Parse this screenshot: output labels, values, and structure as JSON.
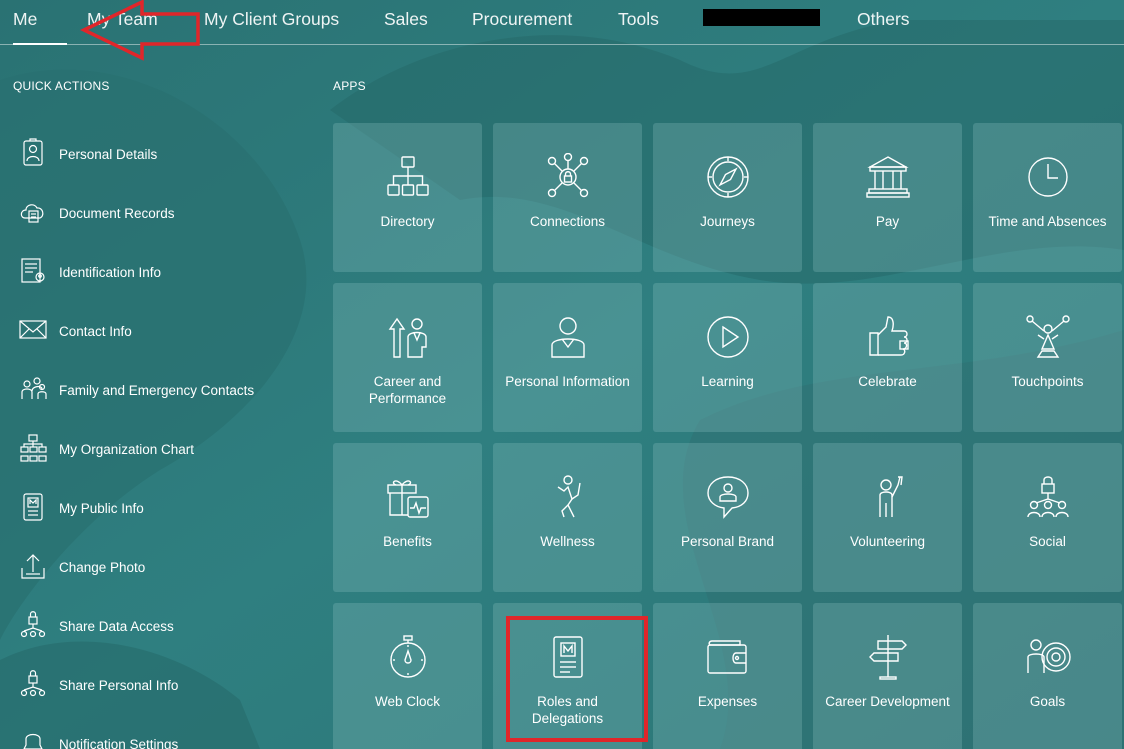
{
  "nav": {
    "tabs": [
      "Me",
      "My Team",
      "My Client Groups",
      "Sales",
      "Procurement",
      "Tools",
      "Others"
    ],
    "active_tab": "Me"
  },
  "quick_actions": {
    "heading": "QUICK ACTIONS",
    "items": [
      {
        "label": "Personal Details",
        "icon": "person-card-icon"
      },
      {
        "label": "Document Records",
        "icon": "cloud-document-icon"
      },
      {
        "label": "Identification Info",
        "icon": "id-document-icon"
      },
      {
        "label": "Contact Info",
        "icon": "envelope-icon"
      },
      {
        "label": "Family and Emergency Contacts",
        "icon": "family-icon"
      },
      {
        "label": "My Organization Chart",
        "icon": "org-chart-icon"
      },
      {
        "label": "My Public Info",
        "icon": "badge-icon"
      },
      {
        "label": "Change Photo",
        "icon": "upload-icon"
      },
      {
        "label": "Share Data Access",
        "icon": "share-lock-icon"
      },
      {
        "label": "Share Personal Info",
        "icon": "share-lock-icon"
      },
      {
        "label": "Notification Settings",
        "icon": "bell-icon"
      }
    ]
  },
  "apps": {
    "heading": "APPS",
    "tiles": [
      {
        "label": "Directory",
        "icon": "hierarchy-icon"
      },
      {
        "label": "Connections",
        "icon": "network-lock-icon"
      },
      {
        "label": "Journeys",
        "icon": "compass-icon"
      },
      {
        "label": "Pay",
        "icon": "bank-icon"
      },
      {
        "label": "Time and Absences",
        "icon": "clock-icon"
      },
      {
        "label": "Career and Performance",
        "icon": "career-arrow-icon"
      },
      {
        "label": "Personal Information",
        "icon": "person-icon"
      },
      {
        "label": "Learning",
        "icon": "play-circle-icon"
      },
      {
        "label": "Celebrate",
        "icon": "thumbs-up-icon"
      },
      {
        "label": "Touchpoints",
        "icon": "touchpoints-icon"
      },
      {
        "label": "Benefits",
        "icon": "gift-health-icon"
      },
      {
        "label": "Wellness",
        "icon": "wellness-figure-icon"
      },
      {
        "label": "Personal Brand",
        "icon": "speech-person-icon"
      },
      {
        "label": "Volunteering",
        "icon": "raised-hand-icon"
      },
      {
        "label": "Social",
        "icon": "social-lock-icon"
      },
      {
        "label": "Web Clock",
        "icon": "stopwatch-icon"
      },
      {
        "label": "Roles and Delegations",
        "icon": "badge-card-icon"
      },
      {
        "label": "Expenses",
        "icon": "wallet-icon"
      },
      {
        "label": "Career Development",
        "icon": "signpost-icon"
      },
      {
        "label": "Goals",
        "icon": "target-person-icon"
      }
    ]
  },
  "annotations": {
    "highlight_color": "#e0262a",
    "highlighted_tile": "Roles and Delegations"
  }
}
